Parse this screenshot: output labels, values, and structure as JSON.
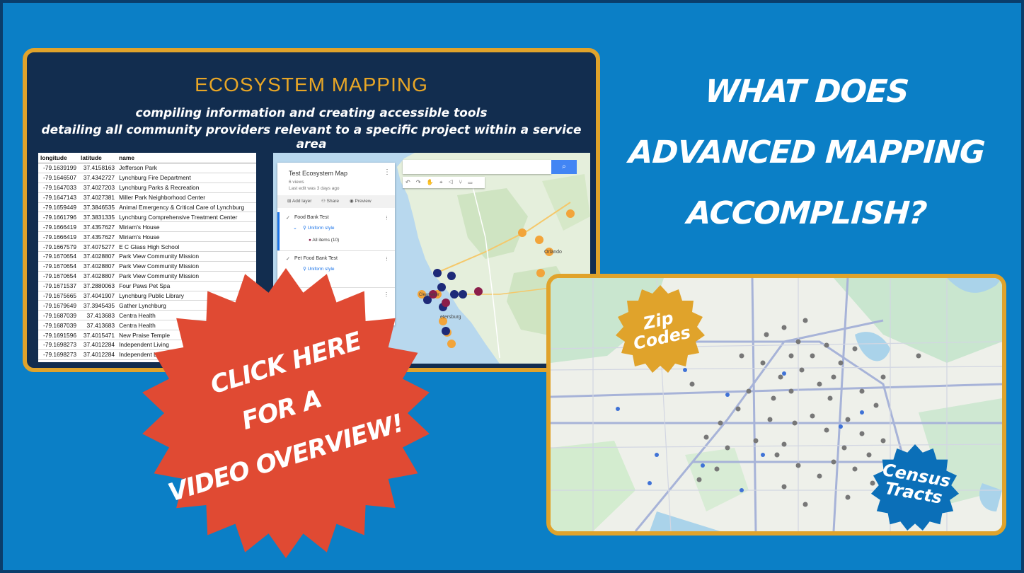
{
  "ecosystem": {
    "title": "ECOSYSTEM MAPPING",
    "subtitle_line1": "compiling information and creating accessible tools",
    "subtitle_line2": "detailing all community providers relevant to a specific project within a service area"
  },
  "spreadsheet": {
    "columns": [
      "longitude",
      "latitude",
      "name"
    ],
    "rows": [
      [
        "-79.1639199",
        "37.4158163",
        "Jefferson Park"
      ],
      [
        "-79.1646507",
        "37.4342727",
        "Lynchburg Fire Department"
      ],
      [
        "-79.1647033",
        "37.4027203",
        "Lynchburg Parks & Recreation"
      ],
      [
        "-79.1647143",
        "37.4027381",
        "Miller Park Neighborhood Center"
      ],
      [
        "-79.1659449",
        "37.3846535",
        "Animal Emergency & Critical Care of Lynchburg"
      ],
      [
        "-79.1661796",
        "37.3831335",
        "Lynchburg Comprehensive Treatment Center"
      ],
      [
        "-79.1666419",
        "37.4357627",
        "Miriam's House"
      ],
      [
        "-79.1666419",
        "37.4357627",
        "Miriam's House"
      ],
      [
        "-79.1667579",
        "37.4075277",
        "E C Glass High School"
      ],
      [
        "-79.1670654",
        "37.4028807",
        "Park View Community Mission"
      ],
      [
        "-79.1670654",
        "37.4028807",
        "Park View Community Mission"
      ],
      [
        "-79.1670654",
        "37.4028807",
        "Park View Community Mission"
      ],
      [
        "-79.1671537",
        "37.2880063",
        "Four Paws Pet Spa"
      ],
      [
        "-79.1675665",
        "37.4041907",
        "Lynchburg Public Library"
      ],
      [
        "-79.1679649",
        "37.3945435",
        "Gather Lynchburg"
      ],
      [
        "-79.1687039",
        "37.413683",
        "Centra Health"
      ],
      [
        "-79.1687039",
        "37.413683",
        "Centra Health"
      ],
      [
        "-79.1691596",
        "37.4015471",
        "New Praise Temple"
      ],
      [
        "-79.1698273",
        "37.4012284",
        "Independent Living"
      ],
      [
        "-79.1698273",
        "37.4012284",
        "Independent Living"
      ]
    ]
  },
  "mymaps": {
    "title": "Test Ecosystem Map",
    "views": "6 views",
    "last_edit": "Last edit was 3 days ago",
    "add_layer": "Add layer",
    "share": "Share",
    "preview": "Preview",
    "layer1_title": "Food Bank Test",
    "layer1_style": "Uniform style",
    "layer1_items": "All items (10)",
    "layer2_title": "Pet Food Bank Test",
    "layer2_style": "Uniform style",
    "search_icon": "search-icon",
    "tools_icons": "↶ ↷ ✋ ⌖ ◁ ⑂ ▭",
    "city_label_orlando": "Orlando",
    "city_label_clearwater": "Clearwater",
    "city_label_petersburg": "etersburg"
  },
  "heading": {
    "line1": "WHAT DOES",
    "line2": "ADVANCED MAPPING",
    "line3": "ACCOMPLISH?"
  },
  "badges": {
    "zip_line1": "Zip",
    "zip_line2": "Codes",
    "census_line1": "Census",
    "census_line2": "Tracts",
    "cta_line1": "CLICK HERE",
    "cta_line2": "FOR A",
    "cta_line3": "VIDEO OVERVIEW!"
  },
  "colors": {
    "background": "#0b7fc6",
    "card_dark": "#122d4f",
    "gold": "#e0a32b",
    "cta_red": "#e04a33",
    "census_blue": "#0b6fb8"
  }
}
